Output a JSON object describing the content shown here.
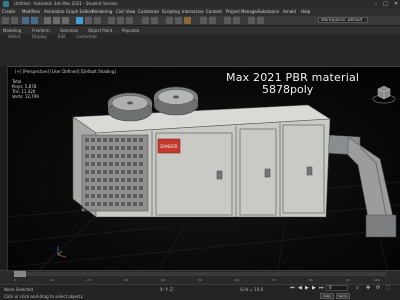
{
  "window": {
    "title": "Untitled - Autodesk 3ds Max 2021 - Student Version",
    "minimize_glyph": "–",
    "maximize_glyph": "□",
    "close_glyph": "✕"
  },
  "menubar": {
    "items": [
      "Create",
      "Modifiers",
      "Animation",
      "Graph Editors",
      "Rendering",
      "Civil View",
      "Customize",
      "Scripting",
      "Interactive",
      "Content",
      "Project Manager",
      "Substance",
      "Arnold",
      "Help"
    ]
  },
  "toolbar": {
    "workspace_label": "Workspaces: Default"
  },
  "ribbon": {
    "tabs": [
      "Modeling",
      "Freeform",
      "Selection",
      "Object Paint",
      "Populate"
    ]
  },
  "subtabs": {
    "items": [
      "Select",
      "Display",
      "Edit",
      "Customize"
    ]
  },
  "viewport": {
    "label": "[+] [Perspective] [User Defined] [Default Shading]",
    "overlay_line1": "Max 2021 PBR material",
    "overlay_line2": "5878poly",
    "stats": {
      "header": "Total",
      "polys_label": "Polys:",
      "polys_value": "5,878",
      "tris_label": "Tris:",
      "tris_value": "11,426",
      "verts_label": "Verts:",
      "verts_value": "12,709"
    },
    "warning_sign_text": "DANGER"
  },
  "timeline": {
    "frame_counter": "0 / 100",
    "ticks": [
      "0",
      "10",
      "20",
      "30",
      "40",
      "50",
      "60",
      "70",
      "80",
      "90",
      "100"
    ]
  },
  "statusbar": {
    "selection_text": "None Selected",
    "prompt_text": "Click or click-and-drag to select objects",
    "coords_text": "X:  Y:  Z:",
    "grid_text": "Grid = 10.0",
    "frame_value": "0",
    "autokey_label": "Auto",
    "setkey_label": "Set K."
  },
  "colors": {
    "accent": "#3ea0d6",
    "sign_red": "#c23b2d",
    "unit_body": "#c9c9c6"
  }
}
